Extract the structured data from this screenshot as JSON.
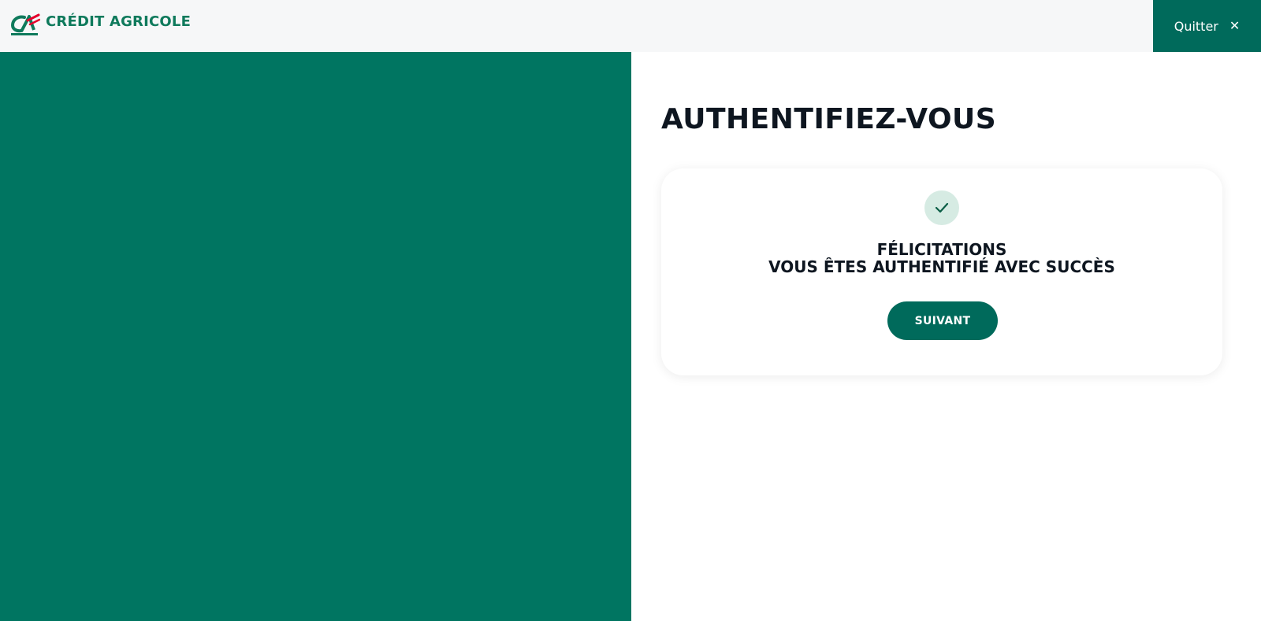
{
  "header": {
    "brand_name": "CRÉDIT AGRICOLE",
    "quit_label": "Quitter",
    "quit_icon": "close-icon"
  },
  "main": {
    "title": "AUTHENTIFIEZ-VOUS",
    "card": {
      "icon": "check-icon",
      "line1": "FÉLICITATIONS",
      "line2": "VOUS ÊTES AUTHENTIFIÉ AVEC SUCCÈS",
      "next_label": "SUIVANT"
    }
  },
  "colors": {
    "brand_green": "#007561",
    "button_green": "#006a5b",
    "check_bg": "#d6ebe3",
    "header_bg": "#f6f7f8",
    "logo_red": "#e4002b"
  }
}
